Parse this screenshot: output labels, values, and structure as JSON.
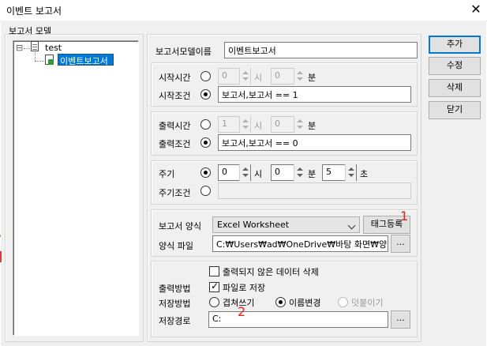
{
  "window": {
    "title": "이벤트 보고서",
    "close_glyph": "✕"
  },
  "tree": {
    "group_label": "보고서 모델",
    "root": {
      "expander": "⊟",
      "label": "test"
    },
    "child": {
      "label": "이벤트보고서"
    }
  },
  "form": {
    "model_name_label": "보고서모델이름",
    "model_name_value": "이벤트보고서",
    "start": {
      "time_label": "시작시간",
      "hour_value": "0",
      "hour_unit": "시",
      "minute_value": "0",
      "minute_unit": "분",
      "condition_label": "시작조건",
      "condition_value": "보고서,보고서 == 1"
    },
    "output": {
      "time_label": "출력시간",
      "hour_value": "1",
      "hour_unit": "시",
      "minute_value": "0",
      "minute_unit": "분",
      "condition_label": "출력조건",
      "condition_value": "보고서,보고서 == 0"
    },
    "cycle": {
      "label": "주기",
      "hour_value": "0",
      "hour_unit": "시",
      "minute_value": "0",
      "minute_unit": "분",
      "second_value": "5",
      "second_unit": "초",
      "condition_label": "주기조건",
      "condition_value": ""
    },
    "report": {
      "format_label": "보고서 양식",
      "format_value": "Excel Worksheet",
      "tag_button": "태그등록",
      "file_label": "양식 파일",
      "file_value": "C:₩Users₩ad₩OneDrive₩바탕 화면₩양식",
      "browse": "..."
    },
    "output_opts": {
      "delete_unprinted_label": "출력되지 않은 데이터 삭제",
      "method_label": "출력방법",
      "save_to_file_label": "파일로 저장",
      "save_method_label": "저장방법",
      "overwrite_label": "겹쳐쓰기",
      "rename_label": "이름변경",
      "append_label": "덧붙이기",
      "path_label": "저장경로",
      "path_value": "C:",
      "browse": "..."
    }
  },
  "buttons": {
    "add": "추가",
    "edit": "수정",
    "delete": "삭제",
    "close": "닫기"
  },
  "annotations": {
    "one": "1",
    "two": "2"
  }
}
